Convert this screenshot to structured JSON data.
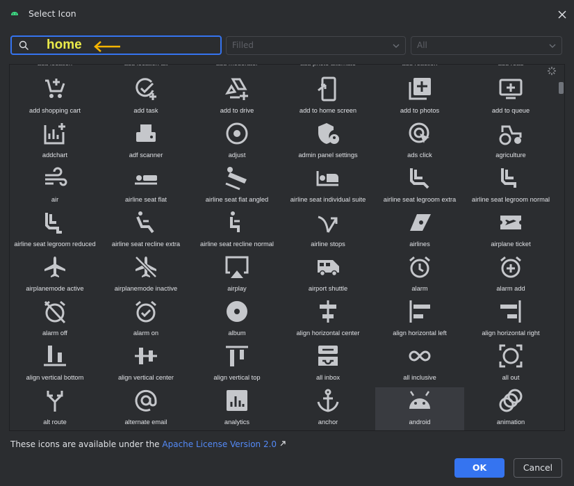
{
  "window": {
    "title": "Select Icon",
    "accent": "#3574f0"
  },
  "search": {
    "value": "home"
  },
  "filters": {
    "style": "Filled",
    "category": "All"
  },
  "top_row": [
    "add location",
    "add location alt",
    "add moderator",
    "add photo alternate",
    "add reaction",
    "add road"
  ],
  "icons": [
    {
      "label": "add shopping cart",
      "icon": "add-shopping-cart-icon"
    },
    {
      "label": "add task",
      "icon": "add-task-icon"
    },
    {
      "label": "add to drive",
      "icon": "add-to-drive-icon"
    },
    {
      "label": "add to home screen",
      "icon": "add-to-home-screen-icon"
    },
    {
      "label": "add to photos",
      "icon": "add-to-photos-icon"
    },
    {
      "label": "add to queue",
      "icon": "add-to-queue-icon"
    },
    {
      "label": "addchart",
      "icon": "addchart-icon"
    },
    {
      "label": "adf scanner",
      "icon": "adf-scanner-icon"
    },
    {
      "label": "adjust",
      "icon": "adjust-icon"
    },
    {
      "label": "admin panel settings",
      "icon": "admin-panel-settings-icon"
    },
    {
      "label": "ads click",
      "icon": "ads-click-icon"
    },
    {
      "label": "agriculture",
      "icon": "agriculture-icon"
    },
    {
      "label": "air",
      "icon": "air-icon"
    },
    {
      "label": "airline seat flat",
      "icon": "airline-seat-flat-icon"
    },
    {
      "label": "airline seat flat angled",
      "icon": "airline-seat-flat-angled-icon"
    },
    {
      "label": "airline seat individual suite",
      "icon": "airline-seat-individual-suite-icon"
    },
    {
      "label": "airline seat legroom extra",
      "icon": "airline-seat-legroom-extra-icon"
    },
    {
      "label": "airline seat legroom normal",
      "icon": "airline-seat-legroom-normal-icon"
    },
    {
      "label": "airline seat legroom reduced",
      "icon": "airline-seat-legroom-reduced-icon"
    },
    {
      "label": "airline seat recline extra",
      "icon": "airline-seat-recline-extra-icon"
    },
    {
      "label": "airline seat recline normal",
      "icon": "airline-seat-recline-normal-icon"
    },
    {
      "label": "airline stops",
      "icon": "airline-stops-icon"
    },
    {
      "label": "airlines",
      "icon": "airlines-icon"
    },
    {
      "label": "airplane ticket",
      "icon": "airplane-ticket-icon"
    },
    {
      "label": "airplanemode active",
      "icon": "airplanemode-active-icon"
    },
    {
      "label": "airplanemode inactive",
      "icon": "airplanemode-inactive-icon"
    },
    {
      "label": "airplay",
      "icon": "airplay-icon"
    },
    {
      "label": "airport shuttle",
      "icon": "airport-shuttle-icon"
    },
    {
      "label": "alarm",
      "icon": "alarm-icon"
    },
    {
      "label": "alarm add",
      "icon": "alarm-add-icon"
    },
    {
      "label": "alarm off",
      "icon": "alarm-off-icon"
    },
    {
      "label": "alarm on",
      "icon": "alarm-on-icon"
    },
    {
      "label": "album",
      "icon": "album-icon"
    },
    {
      "label": "align horizontal center",
      "icon": "align-horizontal-center-icon"
    },
    {
      "label": "align horizontal left",
      "icon": "align-horizontal-left-icon"
    },
    {
      "label": "align horizontal right",
      "icon": "align-horizontal-right-icon"
    },
    {
      "label": "align vertical bottom",
      "icon": "align-vertical-bottom-icon"
    },
    {
      "label": "align vertical center",
      "icon": "align-vertical-center-icon"
    },
    {
      "label": "align vertical top",
      "icon": "align-vertical-top-icon"
    },
    {
      "label": "all inbox",
      "icon": "all-inbox-icon"
    },
    {
      "label": "all inclusive",
      "icon": "all-inclusive-icon"
    },
    {
      "label": "all out",
      "icon": "all-out-icon"
    },
    {
      "label": "alt route",
      "icon": "alt-route-icon"
    },
    {
      "label": "alternate email",
      "icon": "alternate-email-icon"
    },
    {
      "label": "analytics",
      "icon": "analytics-icon"
    },
    {
      "label": "anchor",
      "icon": "anchor-icon"
    },
    {
      "label": "android",
      "icon": "android-icon",
      "selected": true
    },
    {
      "label": "animation",
      "icon": "animation-icon"
    }
  ],
  "footer": {
    "text": "These icons are available under the ",
    "link": "Apache License Version 2.0"
  },
  "buttons": {
    "ok": "OK",
    "cancel": "Cancel"
  }
}
